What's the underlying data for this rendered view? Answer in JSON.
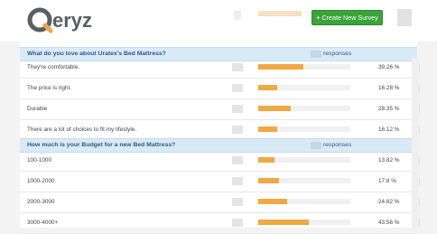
{
  "header": {
    "logo_text": "Qeryz",
    "create_button_label": "Create New Survey"
  },
  "sections": [
    {
      "question": "What do you love about Uratex's Bed Mattress?",
      "responses_label": "responses",
      "rows": [
        {
          "label": "They're comfortable.",
          "percent_text": "39.26 %",
          "percent": 39.26
        },
        {
          "label": "The price is right.",
          "percent_text": "16.28 %",
          "percent": 16.28
        },
        {
          "label": "Durable",
          "percent_text": "28.35 %",
          "percent": 28.35
        },
        {
          "label": "There are a lot of choices to fit my lifestyle.",
          "percent_text": "16.12 %",
          "percent": 16.12
        }
      ]
    },
    {
      "question": "How much is your Budget for a new Bed Mattress?",
      "responses_label": "responses",
      "rows": [
        {
          "label": "100-1000",
          "percent_text": "13.82 %",
          "percent": 13.82
        },
        {
          "label": "1000-2000",
          "percent_text": "17.8 %",
          "percent": 17.8
        },
        {
          "label": "2000-3000",
          "percent_text": "24.82 %",
          "percent": 24.82
        },
        {
          "label": "3000-4000+",
          "percent_text": "43.56 %",
          "percent": 43.56
        }
      ]
    }
  ],
  "colors": {
    "accent_bar": "#f0a844",
    "header_bg": "#d9eaf7",
    "button_green": "#3aa33a",
    "logo_gray": "#5a5f66"
  }
}
